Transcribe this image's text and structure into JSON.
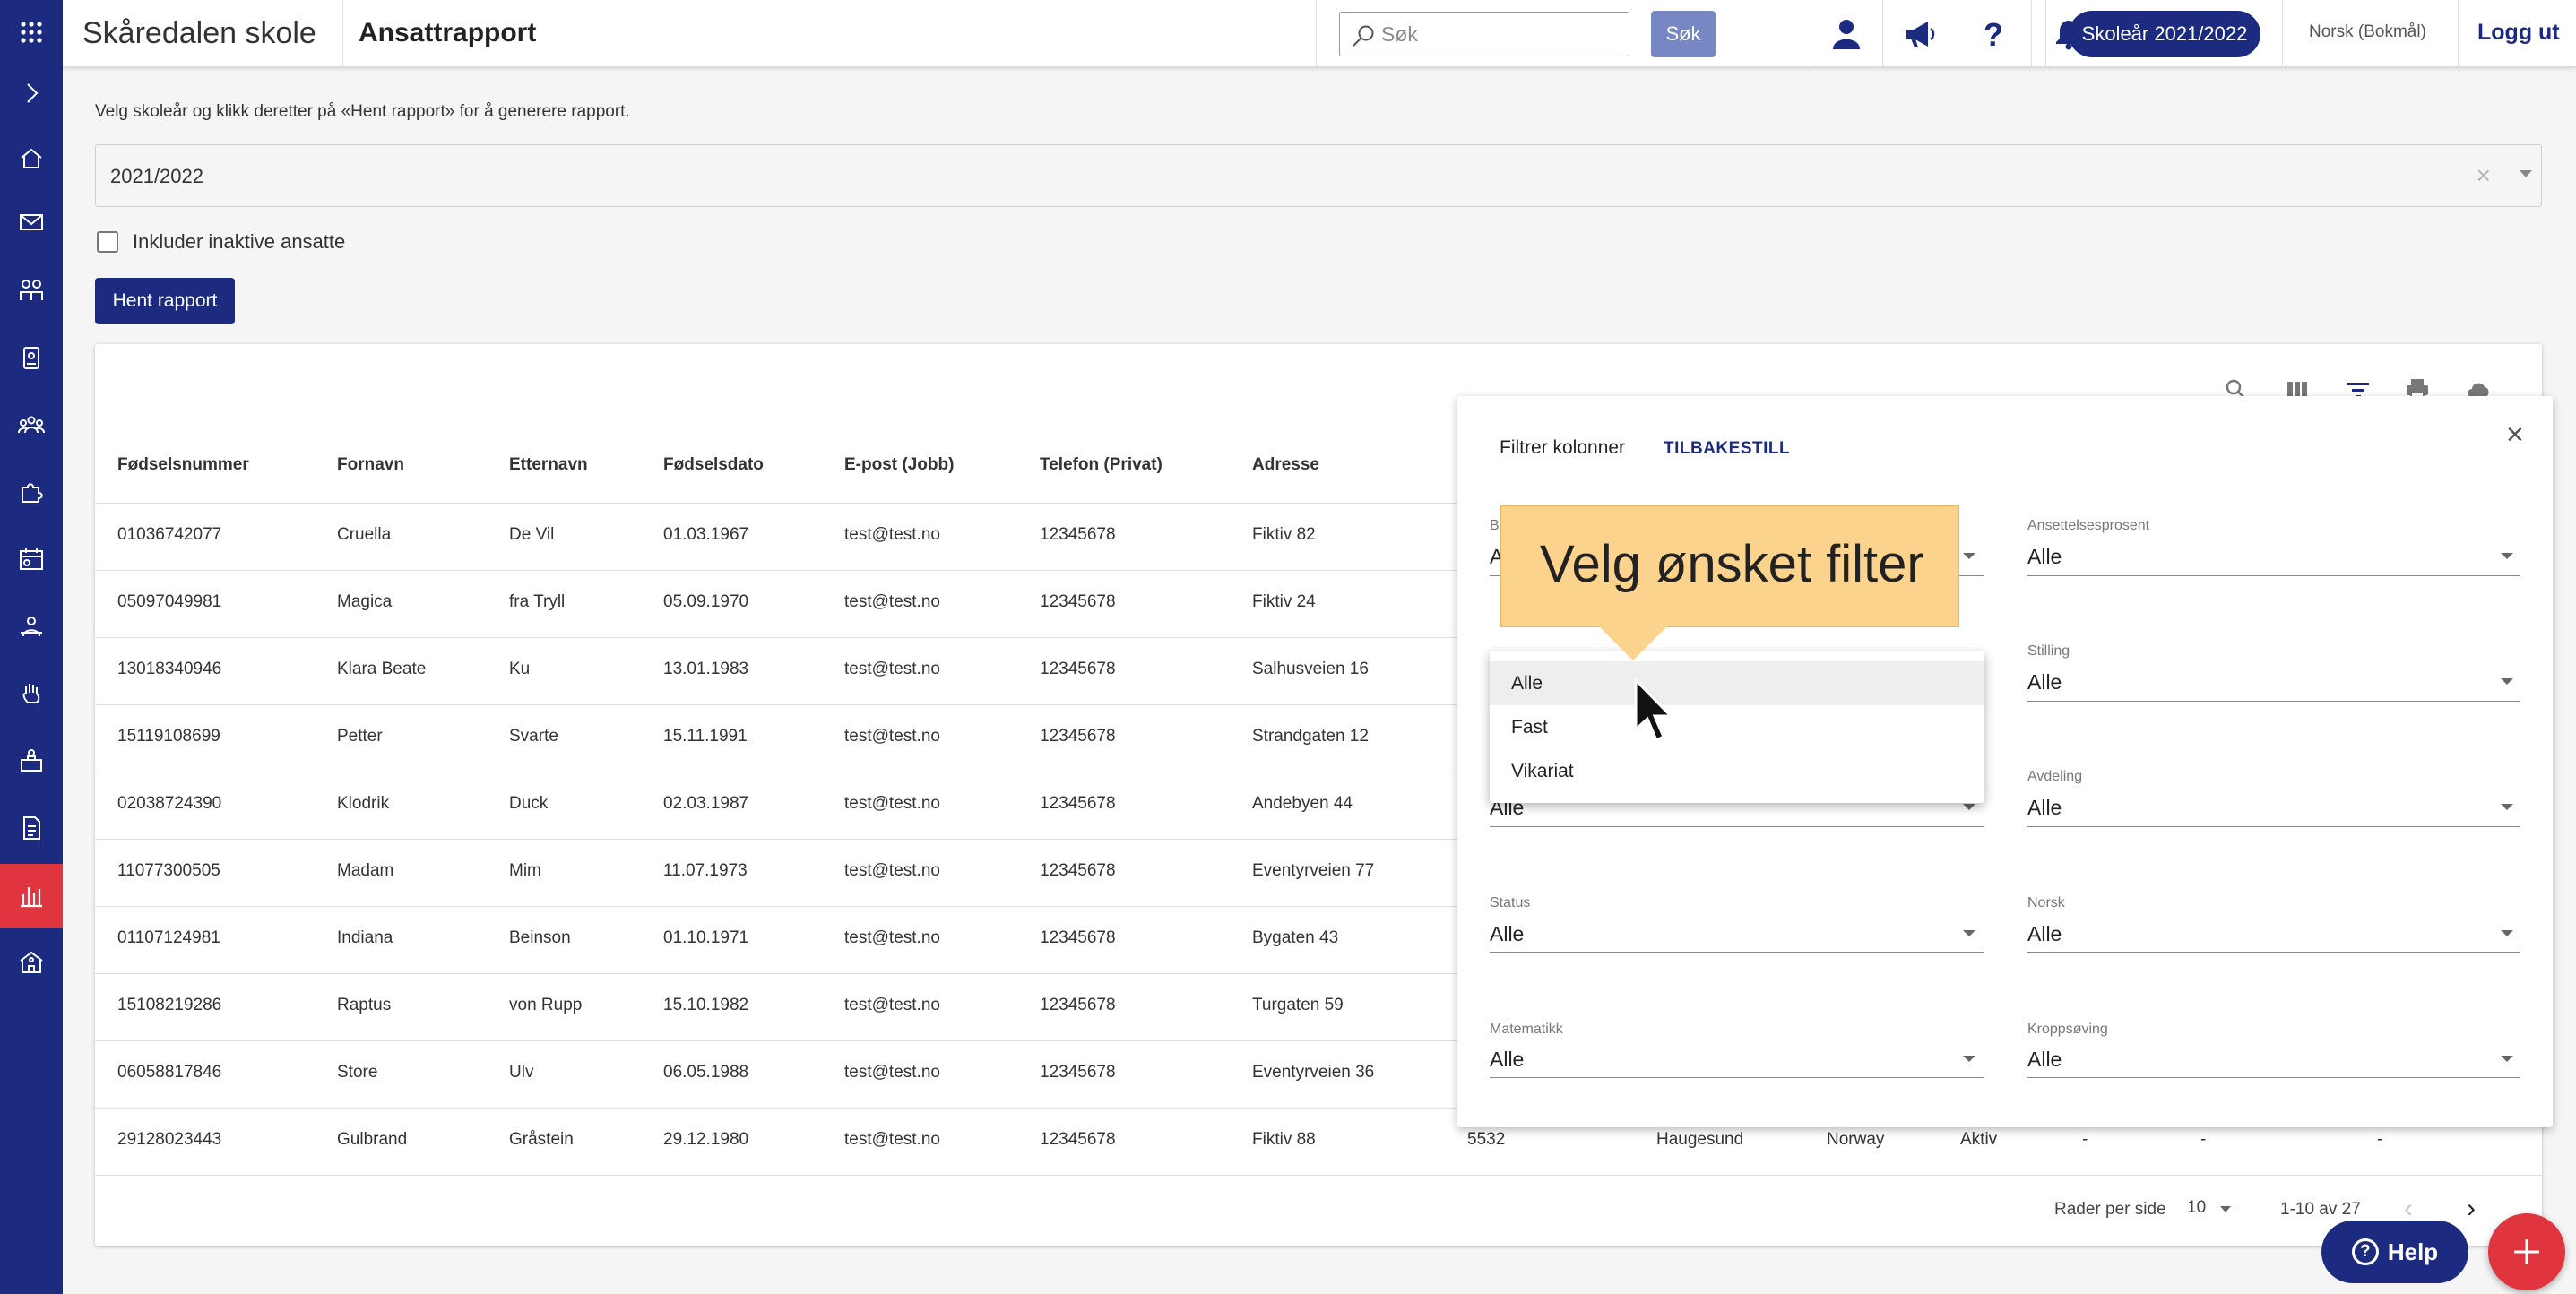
{
  "header": {
    "school_name": "Skåredalen skole",
    "page_title": "Ansattrapport",
    "search_placeholder": "Søk",
    "search_button": "Søk",
    "school_year_button": "Skoleår 2021/2022",
    "language": "Norsk (Bokmål)",
    "logout": "Logg ut"
  },
  "main": {
    "instruction": "Velg skoleår og klikk deretter på «Hent rapport» for å generere rapport.",
    "year_select_value": "2021/2022",
    "include_inactive_label": "Inkluder inaktive ansatte",
    "fetch_button": "Hent rapport"
  },
  "table": {
    "headers": [
      "Fødselsnummer",
      "Fornavn",
      "Etternavn",
      "Fødselsdato",
      "E-post (Jobb)",
      "Telefon (Privat)",
      "Adresse"
    ],
    "rows": [
      [
        "01036742077",
        "Cruella",
        "De Vil",
        "01.03.1967",
        "test@test.no",
        "12345678",
        "Fiktiv 82"
      ],
      [
        "05097049981",
        "Magica",
        "fra Tryll",
        "05.09.1970",
        "test@test.no",
        "12345678",
        "Fiktiv 24"
      ],
      [
        "13018340946",
        "Klara Beate",
        "Ku",
        "13.01.1983",
        "test@test.no",
        "12345678",
        "Salhusveien 16"
      ],
      [
        "15119108699",
        "Petter",
        "Svarte",
        "15.11.1991",
        "test@test.no",
        "12345678",
        "Strandgaten 12"
      ],
      [
        "02038724390",
        "Klodrik",
        "Duck",
        "02.03.1987",
        "test@test.no",
        "12345678",
        "Andebyen 44"
      ],
      [
        "11077300505",
        "Madam",
        "Mim",
        "11.07.1973",
        "test@test.no",
        "12345678",
        "Eventyrveien 77"
      ],
      [
        "01107124981",
        "Indiana",
        "Beinson",
        "01.10.1971",
        "test@test.no",
        "12345678",
        "Bygaten 43"
      ],
      [
        "15108219286",
        "Raptus",
        "von Rupp",
        "15.10.1982",
        "test@test.no",
        "12345678",
        "Turgaten 59"
      ],
      [
        "06058817846",
        "Store",
        "Ulv",
        "06.05.1988",
        "test@test.no",
        "12345678",
        "Eventyrveien 36"
      ],
      [
        "29128023443",
        "Gulbrand",
        "Gråstein",
        "29.12.1980",
        "test@test.no",
        "12345678",
        "Fiktiv 88"
      ]
    ],
    "last_row_extra": [
      "5532",
      "Haugesund",
      "Norway",
      "Aktiv",
      "-",
      "-",
      "-"
    ]
  },
  "pagination": {
    "rows_per_page_label": "Rader per side",
    "rows_per_page": "10",
    "range": "1-10 av 27"
  },
  "filter": {
    "title": "Filtrer kolonner",
    "reset": "TILBAKESTILL",
    "fields": {
      "ansettelsesprosent": {
        "label": "Ansettelsesprosent",
        "value": "Alle"
      },
      "stilling": {
        "label": "Stilling",
        "value": "Alle"
      },
      "avdeling": {
        "label": "Avdeling",
        "value": "Alle"
      },
      "status": {
        "label": "Status",
        "value": "Alle"
      },
      "norsk": {
        "label": "Norsk",
        "value": "Alle"
      },
      "matematikk": {
        "label": "Matematikk",
        "value": "Alle"
      },
      "kroppsoving": {
        "label": "Kroppsøving",
        "value": "Alle"
      },
      "left_row3_value": "Alle",
      "left_row1_fragment_label": "B",
      "left_row1_fragment_value": "A"
    },
    "dropdown_options": [
      "Alle",
      "Fast",
      "Vikariat"
    ]
  },
  "tooltip": {
    "text": "Velg ønsket filter"
  },
  "help_button": "Help",
  "colors": {
    "brand_navy": "#1c2b7f",
    "active_red": "#e0343f",
    "tooltip_yellow": "#fbd38d"
  }
}
